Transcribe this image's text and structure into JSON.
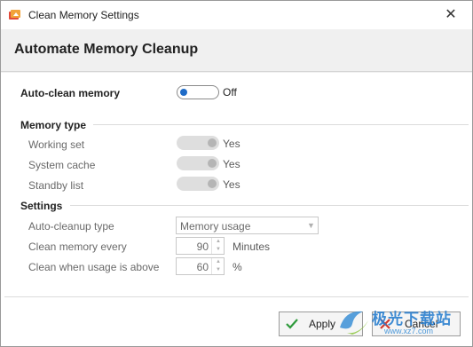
{
  "window": {
    "title": "Clean Memory Settings",
    "close_glyph": "✕"
  },
  "header": {
    "title": "Automate Memory Cleanup"
  },
  "auto_clean": {
    "label": "Auto-clean memory",
    "state": "Off",
    "accent": "#1e6bc7"
  },
  "memory_type": {
    "heading": "Memory type",
    "items": [
      {
        "label": "Working set",
        "value": "Yes"
      },
      {
        "label": "System cache",
        "value": "Yes"
      },
      {
        "label": "Standby list",
        "value": "Yes"
      }
    ]
  },
  "settings": {
    "heading": "Settings",
    "cleanup_type": {
      "label": "Auto-cleanup type",
      "value": "Memory usage"
    },
    "clean_every": {
      "label": "Clean memory every",
      "value": "90",
      "unit": "Minutes"
    },
    "clean_above": {
      "label": "Clean when usage is above",
      "value": "60",
      "unit": "%"
    }
  },
  "buttons": {
    "apply": "Apply",
    "cancel": "Cancel"
  },
  "watermark": {
    "text": "极光下载站",
    "url": "www.xz7.com"
  },
  "icons": [
    "app-icon",
    "close-icon",
    "checkmark-icon",
    "cancel-x-icon",
    "chevron-down-icon",
    "spin-up-icon",
    "spin-down-icon"
  ]
}
